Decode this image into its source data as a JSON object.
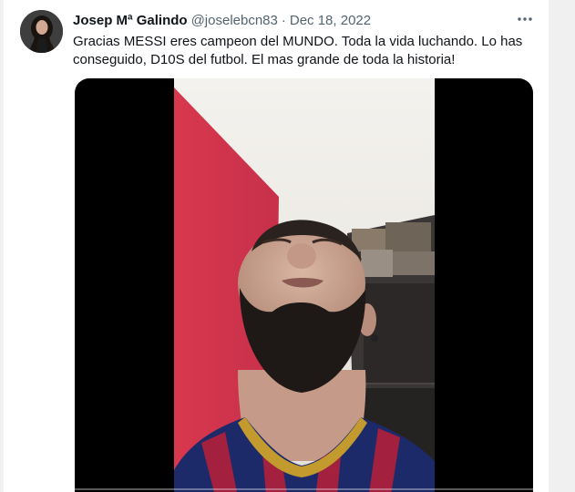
{
  "tweet": {
    "author_name": "Josep Mª Galindo",
    "handle": "@joselebcn83",
    "separator": "·",
    "date": "Dec 18, 2022",
    "text": "Gracias MESSI eres campeon del MUNDO. Toda la vida luchando. Lo has conseguido, D10S del futbol. El mas grande de toda la historia!"
  },
  "icons": {
    "more": "more-options-icon",
    "avatar": "user-avatar"
  },
  "colors": {
    "primary_text": "#0f1419",
    "secondary_text": "#536471",
    "wall_pink": "#d8384e",
    "jersey_blue": "#1d2a6a",
    "jersey_red": "#a3203f"
  },
  "media": {
    "type": "video"
  }
}
